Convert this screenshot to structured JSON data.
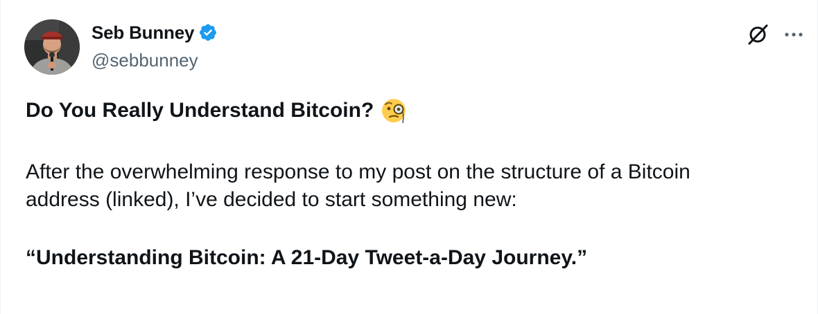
{
  "author": {
    "display_name": "Seb Bunney",
    "handle": "@sebbunney",
    "verified": true,
    "verified_color": "#1d9bf0"
  },
  "actions": {
    "grok_icon": "grok-icon",
    "more_icon": "more-icon"
  },
  "tweet": {
    "title": "Do You Really Understand Bitcoin?",
    "title_emoji": "face-with-monocle",
    "body_line1": "After the overwhelming response to my post on the structure of a Bitcoin",
    "body_line2": "address (linked), I’ve decided to start something new:",
    "series_title": "“Understanding Bitcoin: A 21-Day Tweet-a-Day Journey.”"
  }
}
